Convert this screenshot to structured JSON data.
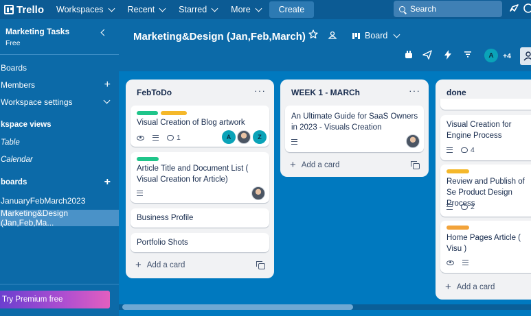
{
  "topbar": {
    "logo": "Trello",
    "nav": [
      "Workspaces",
      "Recent",
      "Starred",
      "More"
    ],
    "create": "Create",
    "search_placeholder": "Search"
  },
  "sidebar": {
    "workspace_name": "Marketing Tasks",
    "plan": "Free",
    "items": [
      {
        "label": "Boards"
      },
      {
        "label": "Members"
      },
      {
        "label": "Workspace settings"
      },
      {
        "label": "kspace views"
      },
      {
        "label": "Table"
      },
      {
        "label": "Calendar"
      },
      {
        "label": "boards"
      },
      {
        "label": "JanuaryFebMarch2023"
      },
      {
        "label": "Marketing&Design (Jan,Feb,Ma..."
      }
    ],
    "premium": "Try Premium free"
  },
  "board": {
    "title": "Marketing&Design (Jan,Feb,March)",
    "view": "Board",
    "members_extra": "+4",
    "member_initial": "A"
  },
  "lists": [
    {
      "title": "FebToDo",
      "add_card": "Add a card",
      "cards": [
        {
          "text": "Visual Creation of Blog artwork",
          "comments": "1",
          "avatars": [
            "A",
            "Z"
          ]
        },
        {
          "text": "Article Title and Document List ( Visual Creation for Article)"
        },
        {
          "text": "Business Profile"
        },
        {
          "text": "Portfolio Shots"
        }
      ]
    },
    {
      "title": "WEEK 1 - MARCh",
      "add_card": "Add a card",
      "cards": [
        {
          "text": "An Ultimate Guide for SaaS Owners in 2023 - Visuals Creation"
        }
      ]
    },
    {
      "title": "done",
      "add_card": "Add a card",
      "cards": [
        {
          "text": "Visual Creation for Engine Process",
          "comments": "4"
        },
        {
          "text": "Review and Publish of Se Product Design Process",
          "comments": "2"
        },
        {
          "text": "Home Pages Article ( Visu )"
        }
      ]
    }
  ],
  "colors": {
    "label_green": "#1fc58a",
    "label_yellow": "#f5b82a",
    "label_orange": "#f2a33a",
    "board_bg": "#0079bf",
    "topbar_bg": "#0c5b94"
  }
}
